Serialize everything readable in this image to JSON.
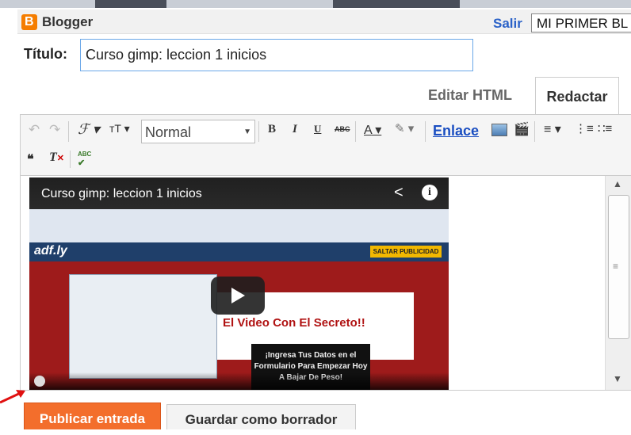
{
  "header": {
    "brand": "Blogger",
    "signout_label": "Salir",
    "blog_name": "MI PRIMER BL"
  },
  "post": {
    "title_label": "Título:",
    "title_value": "Curso gimp: leccion 1 inicios"
  },
  "tabs": [
    {
      "label": "Editar HTML",
      "active": false
    },
    {
      "label": "Redactar",
      "active": true
    }
  ],
  "toolbar": {
    "font_style": "Normal",
    "bold": "B",
    "italic": "I",
    "underline": "U",
    "strike": "ABC",
    "text_color": "A",
    "link_label": "Enlace",
    "quote": "❝",
    "spellcheck": "ABC",
    "icons": [
      "undo-icon",
      "redo-icon",
      "font-family-icon",
      "font-size-icon",
      "bold-icon",
      "italic-icon",
      "underline-icon",
      "strikethrough-icon",
      "text-color-icon",
      "highlight-icon",
      "image-icon",
      "video-icon",
      "align-icon",
      "numbered-list-icon",
      "bullet-list-icon",
      "quote-icon",
      "clear-format-icon",
      "spellcheck-icon"
    ]
  },
  "video": {
    "title": "Curso gimp: leccion 1 inicios",
    "brand_in_video": "adf.ly",
    "skip_ad": "SALTAR PUBLICIDAD",
    "caption": "El Video Con El Secreto!!",
    "box_text": "¡Ingresa Tus Datos en el Formulario Para Empezar Hoy A Bajar De Peso!"
  },
  "actions": {
    "publish_label": "Publicar entrada",
    "save_draft_label": "Guardar como borrador"
  },
  "colors": {
    "publish": "#f36e2c",
    "link_blue": "#1a4ec1",
    "logo_orange": "#f57d00"
  }
}
